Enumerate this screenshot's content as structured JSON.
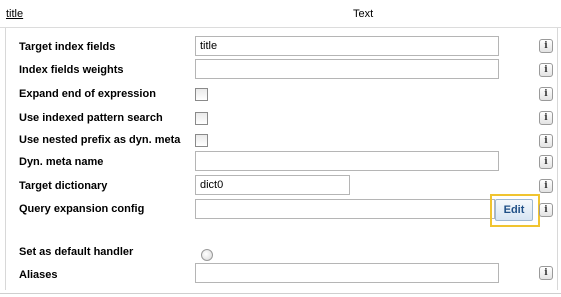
{
  "header": {
    "title_link": "title",
    "type": "Text"
  },
  "fields": {
    "target_index_fields": {
      "label": "Target index fields",
      "value": "title"
    },
    "index_fields_weights": {
      "label": "Index fields weights",
      "value": ""
    },
    "expand_end_of_expression": {
      "label": "Expand end of expression"
    },
    "use_indexed_pattern_search": {
      "label": "Use indexed pattern search"
    },
    "use_nested_prefix": {
      "label": "Use nested prefix as dyn. meta"
    },
    "dyn_meta_name": {
      "label": "Dyn. meta name",
      "value": ""
    },
    "target_dictionary": {
      "label": "Target dictionary",
      "value": "dict0"
    },
    "query_expansion_config": {
      "label": "Query expansion config",
      "value": "",
      "edit_label": "Edit"
    },
    "set_default_handler": {
      "label": "Set as default handler"
    },
    "aliases": {
      "label": "Aliases",
      "value": ""
    }
  },
  "info_glyph": "i",
  "colors": {
    "highlight": "#f0c430",
    "edit_text": "#1f4f86"
  },
  "icons": {
    "info": "info-icon"
  }
}
